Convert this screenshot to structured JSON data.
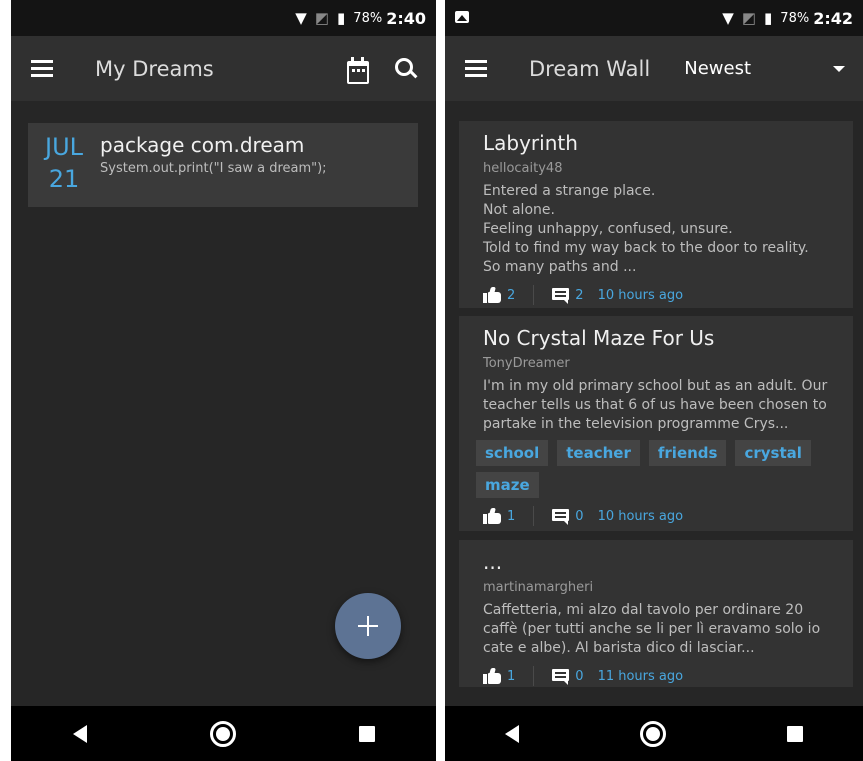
{
  "left": {
    "status": {
      "battery": "78%",
      "time": "2:40"
    },
    "appbar": {
      "title": "My Dreams",
      "menu_icon": "menu-icon",
      "calendar_icon": "calendar-icon",
      "search_icon": "search-icon"
    },
    "dreams": [
      {
        "month": "JUL",
        "day": "21",
        "title": "package com.dream",
        "snippet": "System.out.print(\"I saw a dream\");"
      }
    ],
    "fab_icon": "plus-icon"
  },
  "right": {
    "status": {
      "battery": "78%",
      "time": "2:42"
    },
    "appbar": {
      "title": "Dream Wall",
      "sort": "Newest"
    },
    "cards": [
      {
        "title": "Labyrinth",
        "author": "hellocaity48",
        "body": "Entered a strange place.\nNot alone.\nFeeling unhappy, confused, unsure.\nTold to find my way back to the door to reality.\nSo many paths and ...",
        "tags": [],
        "likes": "2",
        "comments": "2",
        "ago": "10 hours ago"
      },
      {
        "title": "No Crystal Maze For Us",
        "author": "TonyDreamer",
        "body": "I'm in my old primary school but as an adult. Our teacher tells us that 6 of us have been chosen to partake in the television programme Crys...",
        "tags": [
          "school",
          "teacher",
          "friends",
          "crystal",
          "maze"
        ],
        "likes": "1",
        "comments": "0",
        "ago": "10 hours ago"
      },
      {
        "title": "...",
        "author": "martinamargheri",
        "body": "Caffetteria, mi alzo dal tavolo per ordinare 20 caffè (per tutti anche se li per lì eravamo solo io cate e albe). Al barista dico di lasciar...",
        "tags": [],
        "likes": "1",
        "comments": "0",
        "ago": "11 hours ago"
      }
    ]
  },
  "colors": {
    "accent": "#49a7df",
    "fab": "#5d7394",
    "appbar": "#303030",
    "background": "#262626"
  }
}
